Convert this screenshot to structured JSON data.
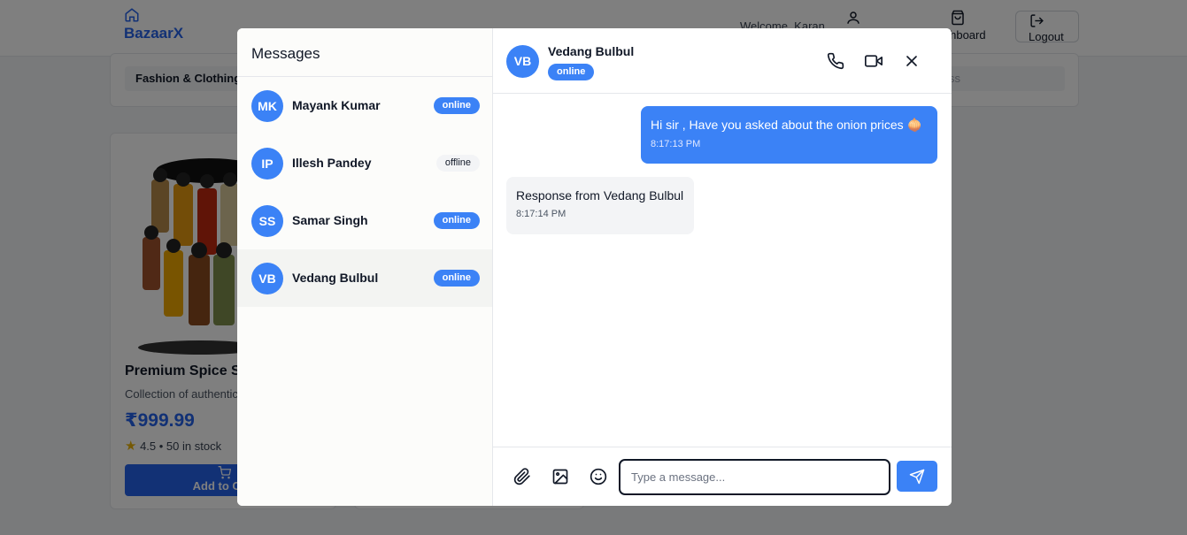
{
  "background": {
    "brand": "BazaarX",
    "welcome": "Welcome, Karan",
    "dashboard_label": "Dashboard",
    "logout_label": "Logout",
    "category_active": "Fashion & Clothing",
    "category_right": "ss",
    "product": {
      "title": "Premium Spice Set",
      "description": "Collection of authentic",
      "price": "₹999.99",
      "rating": "4.5 • 50 in stock",
      "add_to_cart": "Add to Cart"
    }
  },
  "messages": {
    "title": "Messages",
    "contacts": [
      {
        "initials": "MK",
        "name": "Mayank Kumar",
        "status": "online"
      },
      {
        "initials": "IP",
        "name": "Illesh Pandey",
        "status": "offline"
      },
      {
        "initials": "SS",
        "name": "Samar Singh",
        "status": "online"
      },
      {
        "initials": "VB",
        "name": "Vedang Bulbul",
        "status": "online"
      }
    ]
  },
  "chat": {
    "initials": "VB",
    "name": "Vedang Bulbul",
    "status": "online",
    "messages": [
      {
        "text": "Hi sir , Have you asked about the onion prices 🧅",
        "time": "8:17:13 PM",
        "direction": "sent"
      },
      {
        "text": "Response from Vedang Bulbul",
        "time": "8:17:14 PM",
        "direction": "received"
      }
    ],
    "input_placeholder": "Type a message..."
  },
  "colors": {
    "accent": "#3b82f6",
    "brand": "#2563eb"
  }
}
